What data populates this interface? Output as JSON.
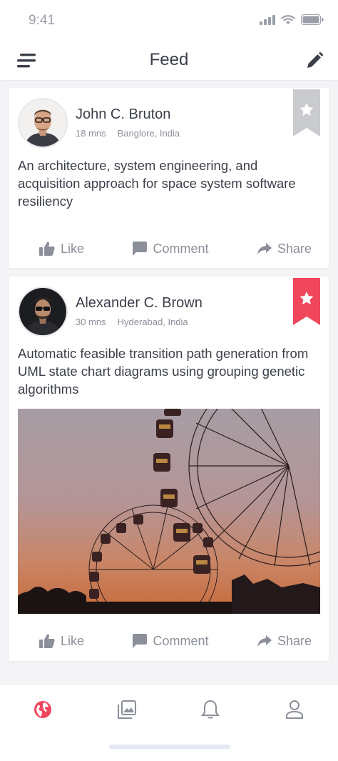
{
  "status_bar": {
    "time": "9:41"
  },
  "nav": {
    "title": "Feed"
  },
  "posts": [
    {
      "author": "John C. Bruton",
      "time": "18 mns",
      "location": "Banglore, India",
      "text": "An architecture, system engineering, and acquisition approach for space system software resiliency",
      "bookmarked": false
    },
    {
      "author": "Alexander C. Brown",
      "time": "30 mns",
      "location": "Hyderabad, India",
      "text": "Automatic feasible transition path generation from UML state chart diagrams using grouping genetic algorithms",
      "bookmarked": true
    }
  ],
  "actions": {
    "like": "Like",
    "comment": "Comment",
    "share": "Share"
  },
  "colors": {
    "accent": "#f0475d",
    "bookmark_inactive": "#c9cbcf",
    "text": "#3b3f4a",
    "muted": "#8a8f99"
  },
  "tab_bar": {
    "items": [
      "globe-icon",
      "gallery-icon",
      "bell-icon",
      "user-icon"
    ],
    "active": "globe-icon"
  }
}
